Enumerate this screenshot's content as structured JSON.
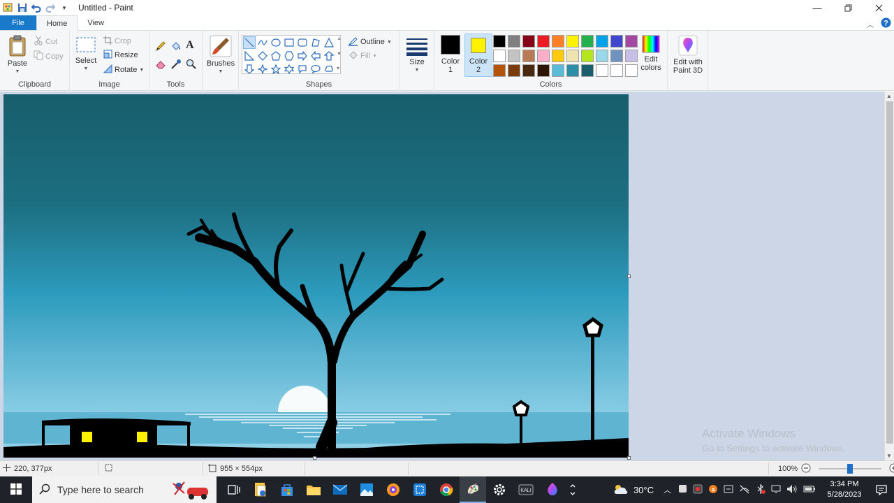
{
  "window": {
    "title": "Untitled - Paint"
  },
  "tabs": {
    "file": "File",
    "home": "Home",
    "view": "View"
  },
  "ribbon": {
    "clipboard": {
      "label": "Clipboard",
      "paste": "Paste",
      "cut": "Cut",
      "copy": "Copy"
    },
    "image": {
      "label": "Image",
      "select": "Select",
      "crop": "Crop",
      "resize": "Resize",
      "rotate": "Rotate"
    },
    "tools": {
      "label": "Tools"
    },
    "brushes": {
      "label": "Brushes"
    },
    "shapes": {
      "label": "Shapes",
      "outline": "Outline",
      "fill": "Fill"
    },
    "size": {
      "label": "Size"
    },
    "colors": {
      "label": "Colors",
      "color1_line1": "Color",
      "color1_line2": "1",
      "color2_line1": "Color",
      "color2_line2": "2",
      "edit_colors_line1": "Edit",
      "edit_colors_line2": "colors",
      "color1_value": "#000000",
      "color2_value": "#fff200",
      "palette": [
        "#000000",
        "#7f7f7f",
        "#880015",
        "#ed1c24",
        "#ff7f27",
        "#fff200",
        "#22b14c",
        "#00a2e8",
        "#3f48cc",
        "#a349a4",
        "#ffffff",
        "#c3c3c3",
        "#b97a57",
        "#ffaec9",
        "#ffc90e",
        "#efe4b0",
        "#b5e61d",
        "#99d9ea",
        "#7092be",
        "#c8bfe7",
        "#b5530a",
        "#7a3a0c",
        "#4a2a0f",
        "#2e1605",
        "#5bbad5",
        "#2b8fa8",
        "#1b5e6b",
        "#ffffff",
        "#ffffff",
        "#ffffff"
      ]
    },
    "paint3d": {
      "line1": "Edit with",
      "line2": "Paint 3D"
    }
  },
  "statusbar": {
    "cursor_pos": "220, 377px",
    "canvas_size": "955 × 554px",
    "zoom": "100%",
    "zoom_level": 0.5
  },
  "watermark": {
    "line1": "Activate Windows",
    "line2": "Go to Settings to activate Windows."
  },
  "taskbar": {
    "search_placeholder": "Type here to search",
    "weather": "30°C",
    "time": "3:34 PM",
    "date": "5/28/2023"
  },
  "scene_colors": {
    "sky_top": "#175e6c",
    "sky_bottom": "#8fd0e8",
    "silhouette": "#000000",
    "window_light": "#fff200"
  }
}
